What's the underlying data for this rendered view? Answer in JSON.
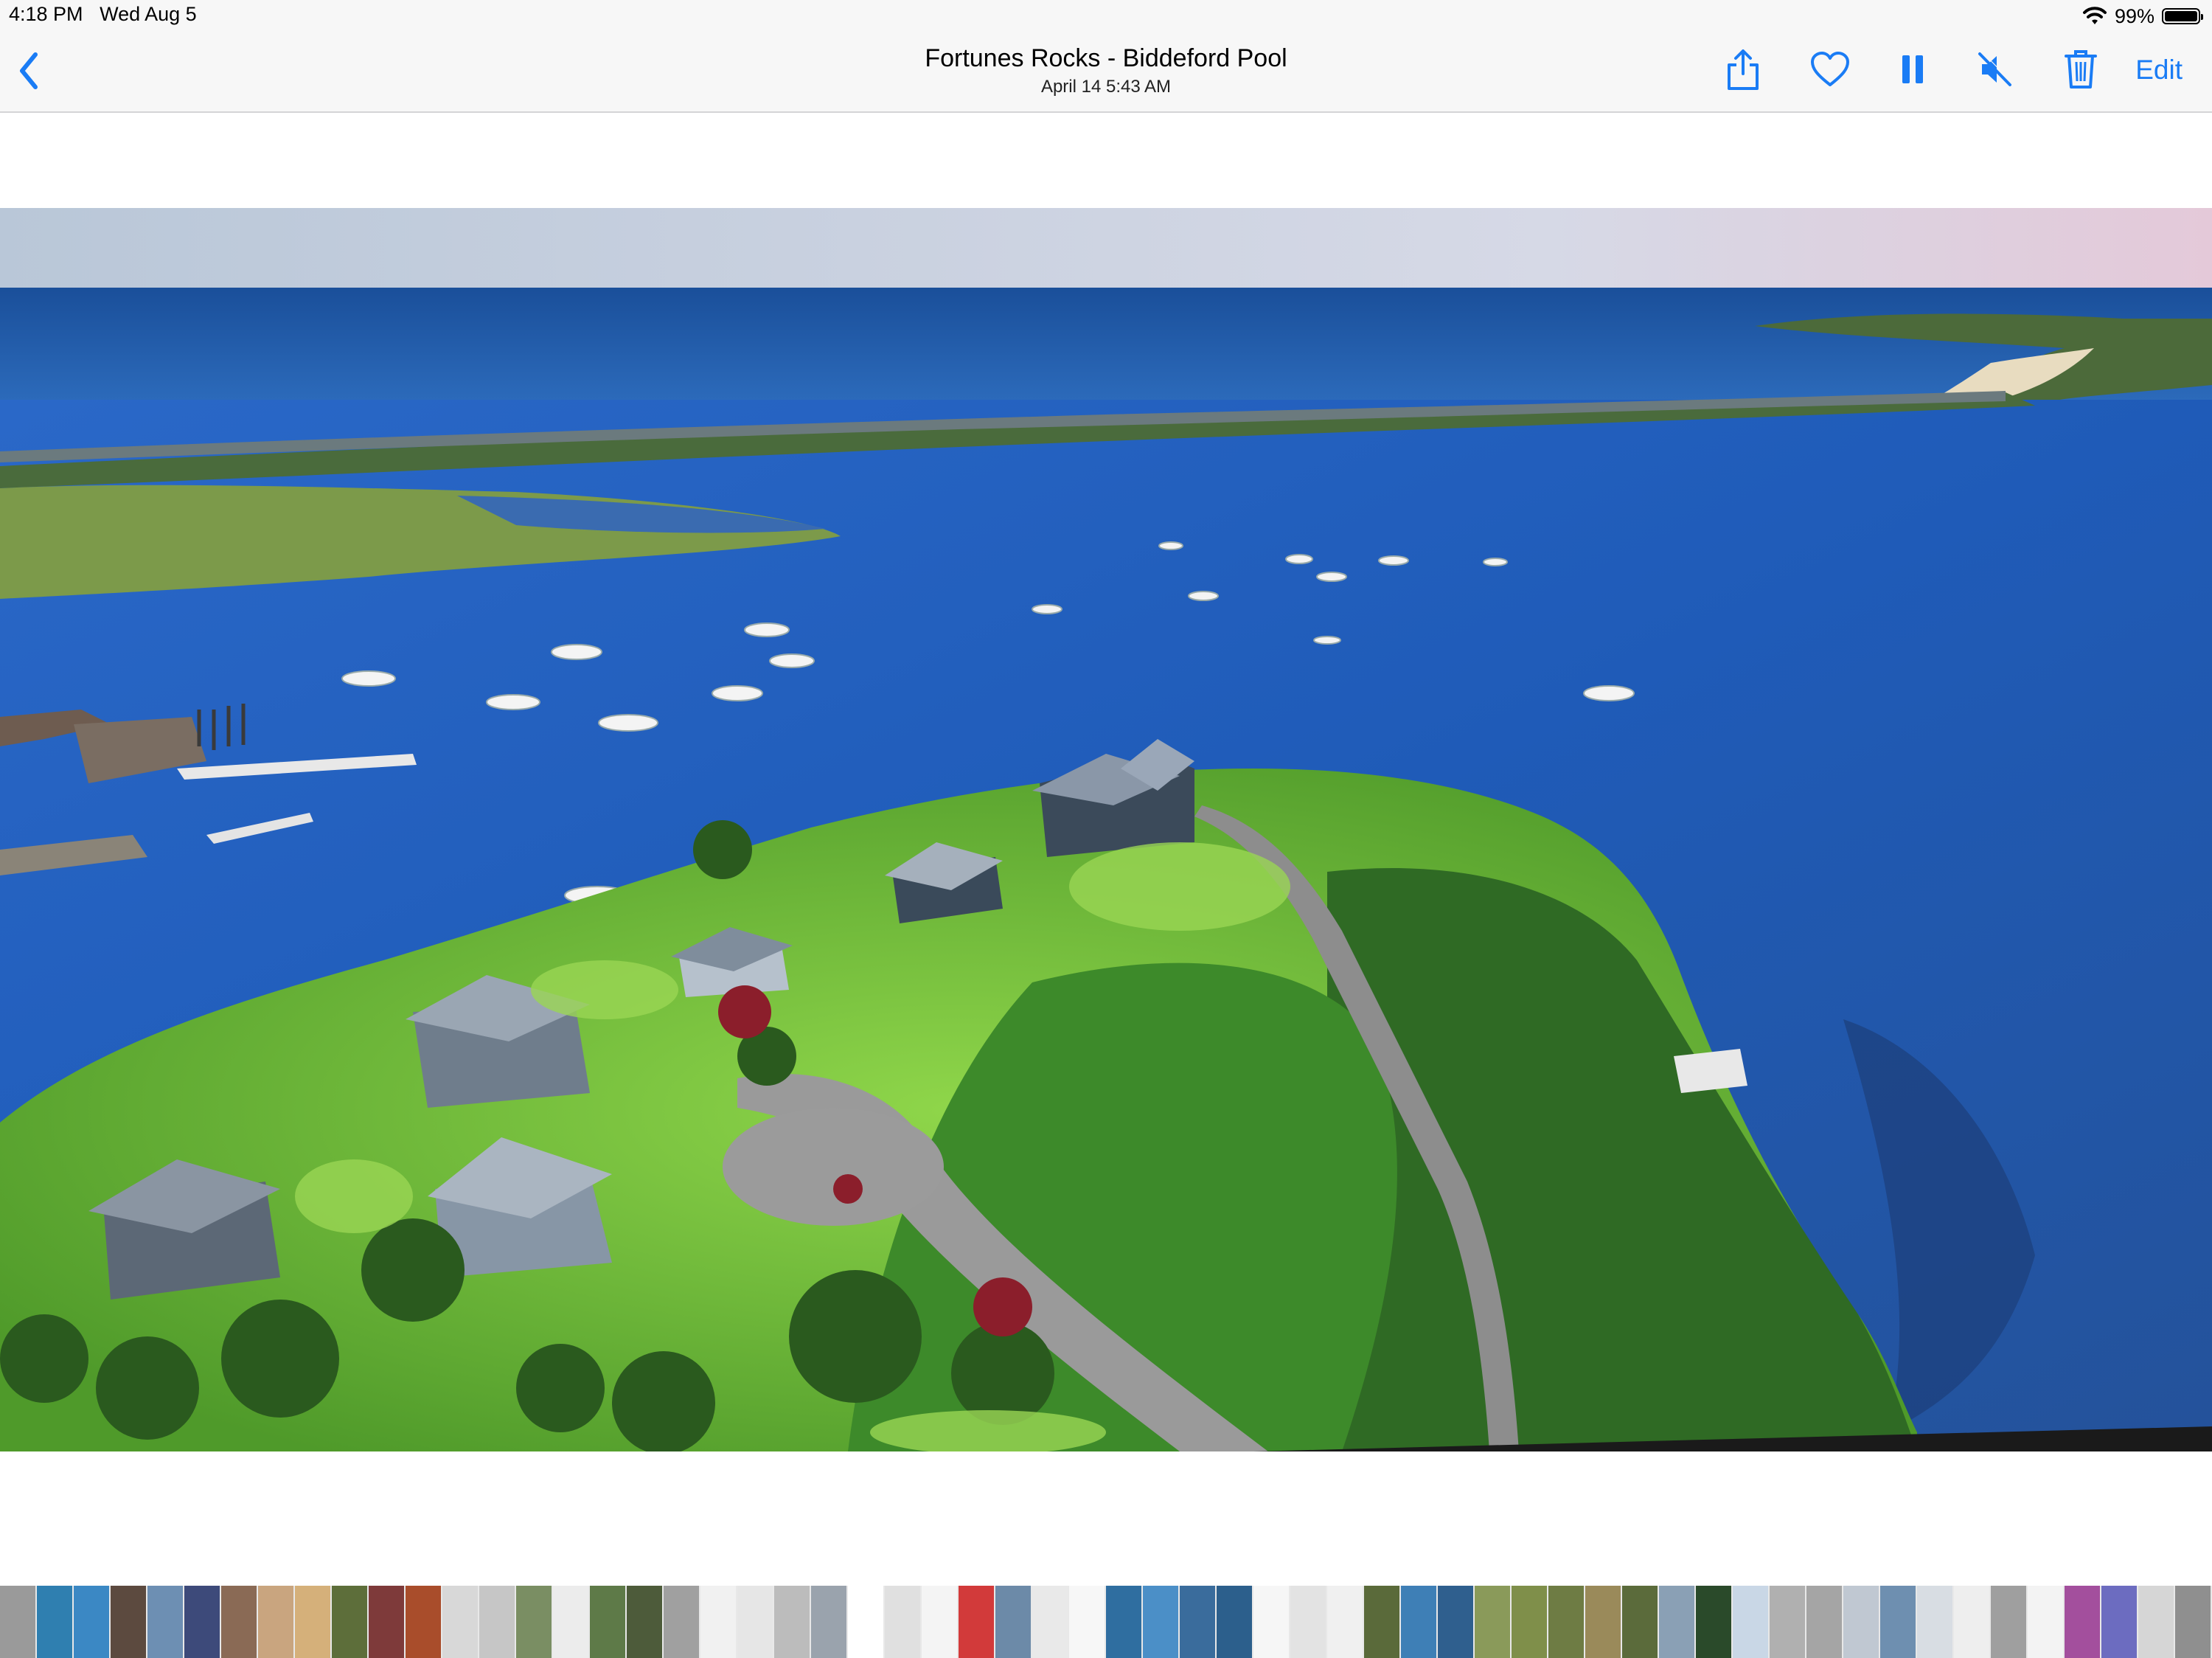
{
  "status_bar": {
    "time": "4:18 PM",
    "date": "Wed Aug 5",
    "battery": "99%",
    "battery_level": 0.99
  },
  "nav": {
    "title": "Fortunes Rocks - Biddeford Pool",
    "subtitle": "April 14  5:43 AM",
    "edit_label": "Edit",
    "icons": [
      "chevron-left-icon",
      "share-icon",
      "heart-icon",
      "pause-icon",
      "speaker-muted-icon",
      "trash-icon"
    ],
    "accent_color": "#1a7cf5"
  },
  "photo": {
    "subject": "aerial view of coastal peninsula with houses, moored boats and ocean"
  },
  "filmstrip": {
    "thumbnail_colors": [
      "#9a9a9a",
      "#2f7fb0",
      "#3b88c4",
      "#5c4a3f",
      "#6d8fb3",
      "#3d4a7a",
      "#8a6a55",
      "#c9a57f",
      "#d5b07a",
      "#5d6e3a",
      "#7e3a3a",
      "#a94d2b",
      "#d8d8d8",
      "#c6c6c6",
      "#7a8e63",
      "#ececec",
      "#5e7a48",
      "#4d5b3a",
      "#a0a0a0",
      "#f1f1f1",
      "#e6e6e6",
      "#bcbcbc",
      "#9aa3ad",
      "#ffffff",
      "#e0e0e0",
      "#f4f4f4",
      "#d23a3a",
      "#6c8aa8",
      "#e9e9e9",
      "#f7f7f7",
      "#2f6ea0",
      "#4b8fc7",
      "#3a6c9c",
      "#2c5f8c",
      "#f6f6f6",
      "#e3e3e3",
      "#f0f0f0",
      "#5a6a3a",
      "#3e7fb6",
      "#2f5f8e",
      "#8a9a5a",
      "#7f8f4a",
      "#6e7c44",
      "#9a8a5a",
      "#5b6b3b",
      "#8aa0b5",
      "#2a4a2a",
      "#c9d7e6",
      "#b0b0b0",
      "#a5a5a5",
      "#c0c8d2",
      "#6e8fb0",
      "#d8dde3",
      "#eeeeee",
      "#9f9f9f",
      "#f3f3f3",
      "#a34f9d",
      "#6c6cc0",
      "#d6d6d6",
      "#8f8f8f",
      "#b9b9b9",
      "#7a8fa3",
      "#c7c7c7",
      "#a98f6a",
      "#b38acb",
      "#9d9d9d"
    ]
  }
}
